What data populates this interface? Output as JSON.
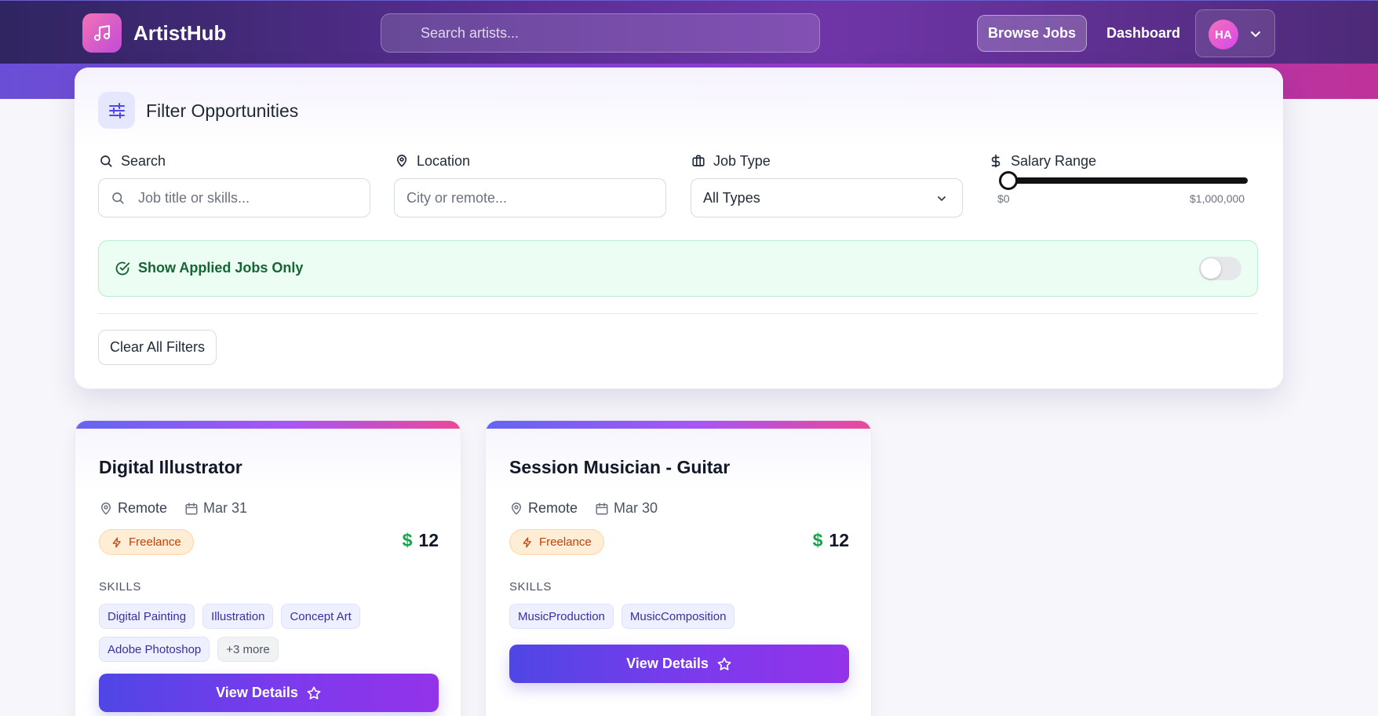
{
  "app": {
    "brand": "ArtistHub",
    "search_placeholder": "Search artists...",
    "nav": {
      "browse_jobs": "Browse Jobs",
      "dashboard": "Dashboard"
    },
    "user": {
      "initials": "HA"
    },
    "icons": {
      "logo": "music-note-icon",
      "menu": "chevron-down-icon"
    }
  },
  "filters": {
    "title": "Filter Opportunities",
    "search": {
      "label": "Search",
      "placeholder": "Job title or skills..."
    },
    "location": {
      "label": "Location",
      "placeholder": "City or remote..."
    },
    "job_type": {
      "label": "Job Type",
      "selected": "All Types"
    },
    "salary": {
      "label": "Salary Range",
      "min_label": "$0",
      "max_label": "$1,000,000",
      "value": 0
    },
    "applied_only": {
      "label": "Show Applied Jobs Only",
      "enabled": false
    },
    "clear_label": "Clear All Filters"
  },
  "jobs": [
    {
      "title": "Digital Illustrator",
      "location": "Remote",
      "date": "Mar 31",
      "type": "Freelance",
      "currency": "$",
      "salary": "12",
      "skills_label": "SKILLS",
      "skills": [
        "Digital Painting",
        "Illustration",
        "Concept Art",
        "Adobe Photoshop"
      ],
      "more": "+3 more",
      "cta": "View Details"
    },
    {
      "title": "Session Musician - Guitar",
      "location": "Remote",
      "date": "Mar 30",
      "type": "Freelance",
      "currency": "$",
      "salary": "12",
      "skills_label": "SKILLS",
      "skills": [
        "MusicProduction",
        "MusicComposition"
      ],
      "cta": "View Details"
    }
  ],
  "colors": {
    "accent": "#4f46e5",
    "accent_end": "#9333ea",
    "success": "#16a34a",
    "freelance_badge": "#c2410c"
  }
}
